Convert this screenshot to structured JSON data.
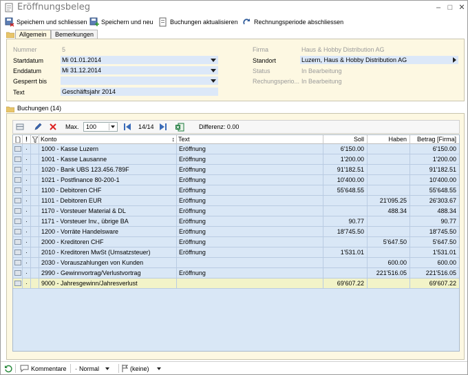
{
  "window": {
    "title": "Eröffnungsbeleg"
  },
  "toolbar": {
    "save_close": "Speichern und schliessen",
    "save_new": "Speichern und neu",
    "refresh": "Buchungen aktualisieren",
    "close_period": "Rechnungsperiode abschliessen"
  },
  "tabs_top": {
    "general": "Allgemein",
    "notes": "Bemerkungen"
  },
  "form": {
    "nummer_label": "Nummer",
    "nummer": "5",
    "startdatum_label": "Startdatum",
    "startdatum": "Mi 01.01.2014",
    "enddatum_label": "Enddatum",
    "enddatum": "Mi 31.12.2014",
    "gesperrt_label": "Gesperrt bis",
    "gesperrt": "",
    "text_label": "Text",
    "text": "Geschäftsjahr 2014",
    "firma_label": "Firma",
    "firma": "Haus & Hobby Distribution AG",
    "standort_label": "Standort",
    "standort": "Luzern, Haus & Hobby Distribution AG",
    "status_label": "Status",
    "status": "In Bearbeitung",
    "rperiode_label": "Rechungsperio...",
    "rperiode": "In Bearbeitung"
  },
  "bookings": {
    "tab": "Buchungen (14)",
    "max_label": "Max.",
    "max_value": "100",
    "page": "14/14",
    "diff": "Differenz: 0.00",
    "columns": {
      "konto": "Konto",
      "text": "Text",
      "soll": "Soll",
      "haben": "Haben",
      "betrag": "Betrag [Firma]",
      "bang": "!",
      "dot": "·"
    },
    "rows": [
      {
        "marker": "·",
        "konto": "1000 - Kasse Luzern",
        "text": "Eröffnung",
        "soll": "6'150.00",
        "haben": "",
        "betrag": "6'150.00"
      },
      {
        "marker": "·",
        "konto": "1001 - Kasse Lausanne",
        "text": "Eröffnung",
        "soll": "1'200.00",
        "haben": "",
        "betrag": "1'200.00"
      },
      {
        "marker": "·",
        "konto": "1020 - Bank UBS 123.456.789F",
        "text": "Eröffnung",
        "soll": "91'182.51",
        "haben": "",
        "betrag": "91'182.51"
      },
      {
        "marker": "·",
        "konto": "1021 - Postfinance 80-200-1",
        "text": "Eröffnung",
        "soll": "10'400.00",
        "haben": "",
        "betrag": "10'400.00"
      },
      {
        "marker": "·",
        "konto": "1100 - Debitoren CHF",
        "text": "Eröffnung",
        "soll": "55'648.55",
        "haben": "",
        "betrag": "55'648.55"
      },
      {
        "marker": "·",
        "konto": "1101 - Debitoren EUR",
        "text": "Eröffnung",
        "soll": "",
        "haben": "21'095.25",
        "betrag": "26'303.67"
      },
      {
        "marker": "·",
        "konto": "1170 - Vorsteuer Material & DL",
        "text": "Eröffnung",
        "soll": "",
        "haben": "488.34",
        "betrag": "488.34"
      },
      {
        "marker": "·",
        "konto": "1171 - Vorsteuer Inv., übrige BA",
        "text": "Eröffnung",
        "soll": "90.77",
        "haben": "",
        "betrag": "90.77"
      },
      {
        "marker": "·",
        "konto": "1200 - Vorräte Handelsware",
        "text": "Eröffnung",
        "soll": "18'745.50",
        "haben": "",
        "betrag": "18'745.50"
      },
      {
        "marker": "·",
        "konto": "2000 - Kreditoren CHF",
        "text": "Eröffnung",
        "soll": "",
        "haben": "5'647.50",
        "betrag": "5'647.50"
      },
      {
        "marker": "·",
        "konto": "2010 - Kreditoren MwSt (Umsatzsteuer)",
        "text": "Eröffnung",
        "soll": "1'531.01",
        "haben": "",
        "betrag": "1'531.01"
      },
      {
        "marker": "·",
        "konto": "2030 - Vorauszahlungen von Kunden",
        "text": "",
        "soll": "",
        "haben": "600.00",
        "betrag": "600.00"
      },
      {
        "marker": "·",
        "konto": "2990 - Gewinnvortrag/Verlustvortrag",
        "text": "Eröffnung",
        "soll": "",
        "haben": "221'516.05",
        "betrag": "221'516.05"
      },
      {
        "marker": "·",
        "konto": "9000 - Jahresgewinn/Jahresverlust",
        "text": "",
        "soll": "69'607.22",
        "haben": "",
        "betrag": "69'607.22"
      }
    ]
  },
  "statusbar": {
    "comments": "Kommentare",
    "priority": "Normal",
    "flag": "(keine)"
  },
  "colors": {
    "panel": "#fdf8e2",
    "field": "#dce8f8",
    "grid": "#d9e7f6",
    "selected_row": "#f2f3c8"
  }
}
